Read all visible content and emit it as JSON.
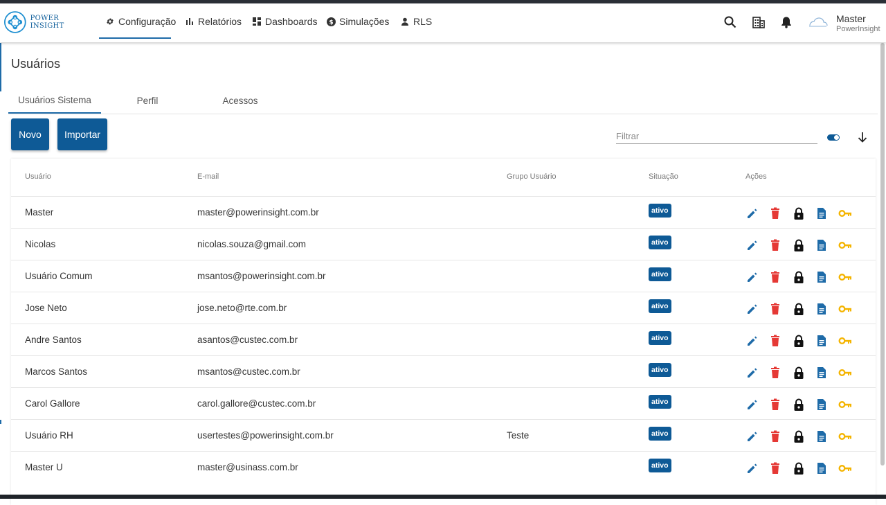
{
  "app": {
    "logo_text": "POWER INSIGHT"
  },
  "nav": {
    "items": [
      {
        "label": "Configuração",
        "icon": "gear-icon",
        "active": true
      },
      {
        "label": "Relatórios",
        "icon": "bar-chart-icon"
      },
      {
        "label": "Dashboards",
        "icon": "dashboard-icon"
      },
      {
        "label": "Simulações",
        "icon": "dollar-icon"
      },
      {
        "label": "RLS",
        "icon": "person-icon"
      }
    ],
    "right_icons": [
      "search-icon",
      "building-icon",
      "bell-icon"
    ],
    "user": {
      "name": "Master",
      "org": "PowerInsight"
    }
  },
  "page": {
    "title": "Usuários",
    "tabs": [
      "Usuários Sistema",
      "Perfil",
      "Acessos"
    ],
    "buttons": {
      "new": "Novo",
      "import": "Importar"
    },
    "filter_placeholder": "Filtrar"
  },
  "table": {
    "headers": {
      "user": "Usuário",
      "email": "E-mail",
      "group": "Grupo Usuário",
      "status": "Situação",
      "actions": "Ações"
    },
    "rows": [
      {
        "user": "Master",
        "email": "master@powerinsight.com.br",
        "group": "",
        "status": "ativo"
      },
      {
        "user": "Nicolas",
        "email": "nicolas.souza@gmail.com",
        "group": "",
        "status": "ativo"
      },
      {
        "user": "Usuário Comum",
        "email": "msantos@powerinsight.com.br",
        "group": "",
        "status": "ativo"
      },
      {
        "user": "Jose Neto",
        "email": "jose.neto@rte.com.br",
        "group": "",
        "status": "ativo"
      },
      {
        "user": "Andre Santos",
        "email": "asantos@custec.com.br",
        "group": "",
        "status": "ativo"
      },
      {
        "user": "Marcos Santos",
        "email": "msantos@custec.com.br",
        "group": "",
        "status": "ativo"
      },
      {
        "user": "Carol Gallore",
        "email": "carol.gallore@custec.com.br",
        "group": "",
        "status": "ativo"
      },
      {
        "user": "Usuário RH",
        "email": "usertestes@powerinsight.com.br",
        "group": "Teste",
        "status": "ativo"
      },
      {
        "user": "Master U",
        "email": "master@usinass.com.br",
        "group": "",
        "status": "ativo"
      }
    ],
    "action_icons": [
      "edit-icon",
      "delete-icon",
      "lock-icon",
      "document-icon",
      "key-icon"
    ]
  },
  "colors": {
    "primary": "#0e5a96",
    "delete": "#e53935",
    "key": "#f4b400",
    "edit": "#1e6ba8"
  }
}
